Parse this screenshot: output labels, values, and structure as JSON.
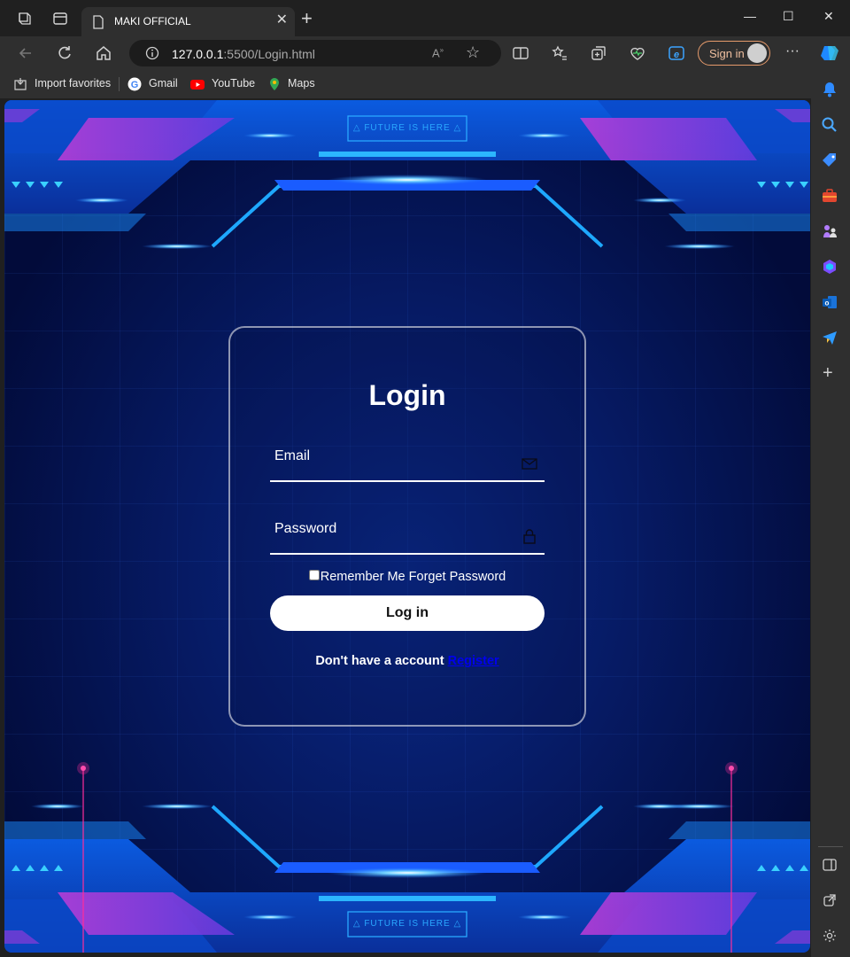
{
  "browser": {
    "tab": {
      "title": "MAKI OFFICIAL",
      "icon": "page-icon"
    },
    "address": {
      "host": "127.0.0.1",
      "rest": ":5500/Login.html",
      "icon": "info-icon"
    },
    "signin_label": "Sign in",
    "favorites": [
      {
        "label": "Import favorites",
        "icon": "import-icon"
      },
      {
        "label": "Gmail",
        "icon": "google-icon"
      },
      {
        "label": "YouTube",
        "icon": "youtube-icon"
      },
      {
        "label": "Maps",
        "icon": "maps-icon"
      }
    ]
  },
  "page": {
    "banner_text_top": "FUTURE IS HERE",
    "banner_text_bottom": "FUTURE IS HERE",
    "login": {
      "title": "Login",
      "email_placeholder": "Email",
      "password_placeholder": "Password",
      "remember_label": "Remember Me Forget Password",
      "button_label": "Log in",
      "account_text": "Don't have a account",
      "register_link": "Register"
    }
  },
  "colors": {
    "accent_cyan": "#1ea8ff",
    "accent_purple": "#a53ad6",
    "accent_pink": "#ff2d9a"
  }
}
